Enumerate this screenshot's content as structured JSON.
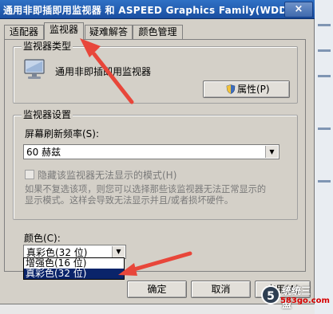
{
  "window": {
    "title": "通用非即插即用监视器 和 ASPEED Graphics Family(WDDM)",
    "close_label": "×"
  },
  "tabs": [
    {
      "label": "适配器"
    },
    {
      "label": "监视器"
    },
    {
      "label": "疑难解答"
    },
    {
      "label": "颜色管理"
    }
  ],
  "monitor_type": {
    "group_title": "监视器类型",
    "device_name": "通用非即插即用监视器",
    "properties_button": "属性(P)"
  },
  "monitor_settings": {
    "group_title": "监视器设置",
    "refresh_label": "屏幕刷新频率(S):",
    "refresh_value": "60 赫兹",
    "hide_modes_label": "隐藏该监视器无法显示的模式(H)",
    "hide_modes_checked": false,
    "description_line1": "如果不复选该项，则您可以选择那些该监视器无法正常显示的",
    "description_line2": "显示模式。这样会导致无法显示并且/或者损坏硬件。"
  },
  "colors": {
    "label": "颜色(C):",
    "value": "真彩色(32 位)",
    "options": [
      {
        "label": "增强色(16 位)",
        "selected": false
      },
      {
        "label": "真彩色(32 位)",
        "selected": true
      }
    ]
  },
  "buttons": {
    "ok": "确定",
    "cancel": "取消",
    "apply": "应用(A)"
  },
  "watermark": {
    "logo": "5",
    "text": "统统三盟",
    "site": "583go.com"
  },
  "colors_theme": {
    "arrow": "#e8463a",
    "titlebar": "#1f5bb5",
    "selection": "#0a246a"
  }
}
